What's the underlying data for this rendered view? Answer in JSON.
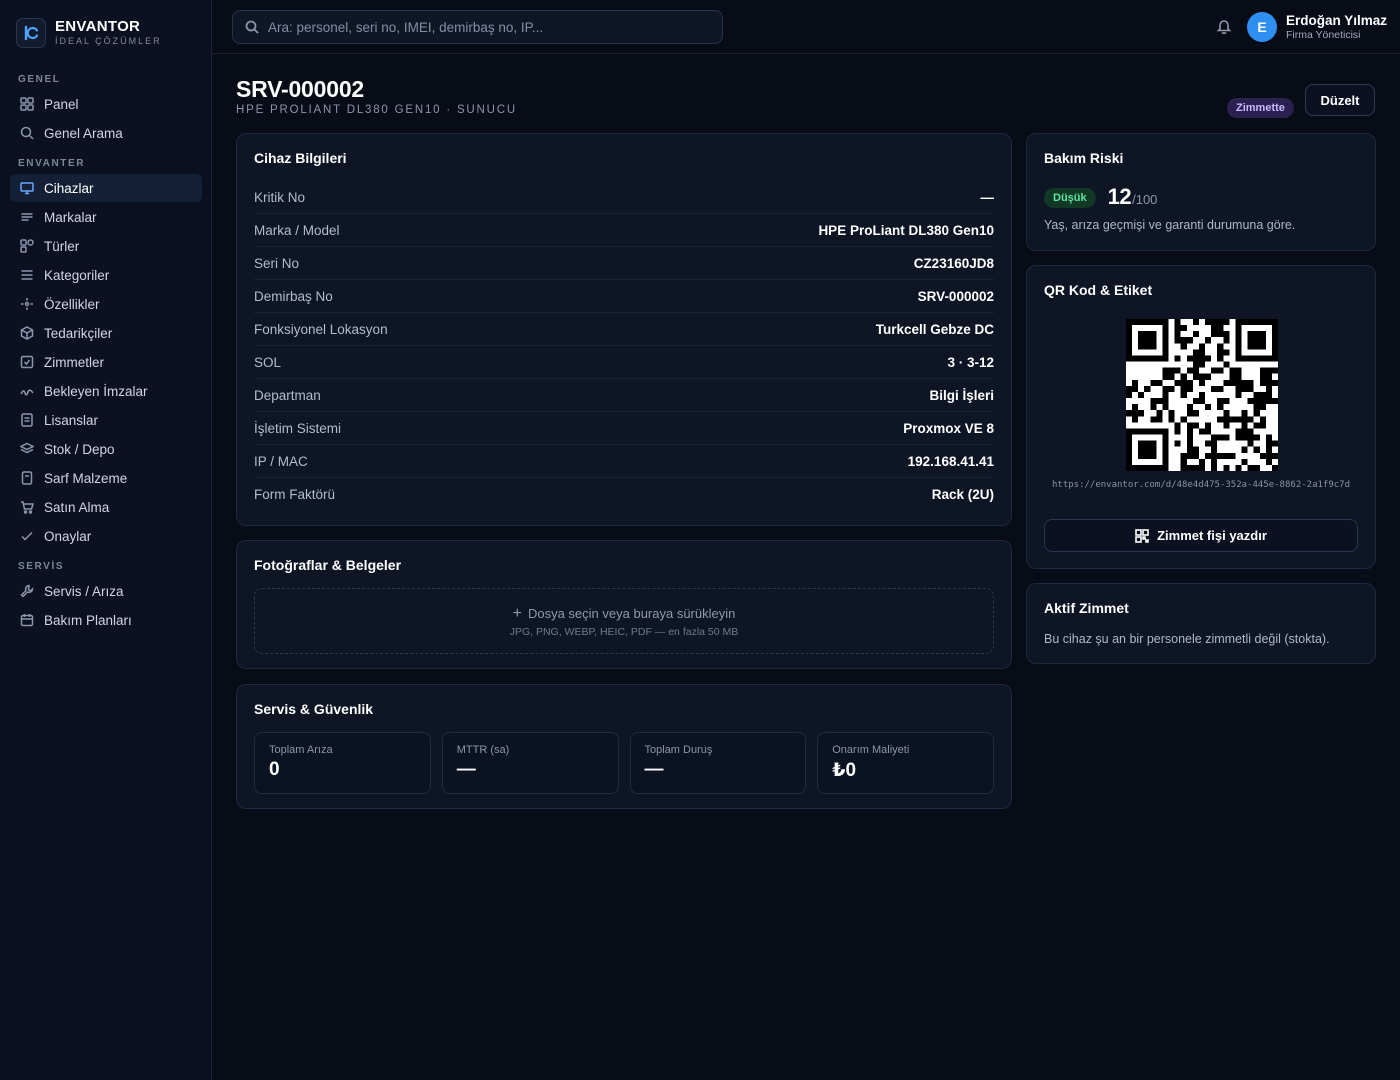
{
  "brand": {
    "name": "ENVANTOR",
    "tagline": "İDEAL ÇÖZÜMLER"
  },
  "sidebar": {
    "sections": [
      {
        "label": "GENEL",
        "items": [
          {
            "label": "Panel",
            "icon": "grid-icon"
          },
          {
            "label": "Genel Arama",
            "icon": "search-icon"
          }
        ]
      },
      {
        "label": "ENVANTER",
        "items": [
          {
            "label": "Cihazlar",
            "icon": "monitor-icon",
            "active": true
          },
          {
            "label": "Markalar",
            "icon": "lines-icon"
          },
          {
            "label": "Türler",
            "icon": "shapes-icon"
          },
          {
            "label": "Kategoriler",
            "icon": "list-icon"
          },
          {
            "label": "Özellikler",
            "icon": "sparkle-icon"
          },
          {
            "label": "Tedarikçiler",
            "icon": "box-icon"
          },
          {
            "label": "Zimmetler",
            "icon": "check-square-icon"
          },
          {
            "label": "Bekleyen İmzalar",
            "icon": "signature-icon"
          },
          {
            "label": "Lisanslar",
            "icon": "document-icon"
          },
          {
            "label": "Stok / Depo",
            "icon": "layers-icon"
          },
          {
            "label": "Sarf Malzeme",
            "icon": "file-icon"
          },
          {
            "label": "Satın Alma",
            "icon": "cart-icon"
          },
          {
            "label": "Onaylar",
            "icon": "check-icon"
          }
        ]
      },
      {
        "label": "SERVİS",
        "items": [
          {
            "label": "Servis / Arıza",
            "icon": "wrench-icon"
          },
          {
            "label": "Bakım Planları",
            "icon": "calendar-icon"
          }
        ]
      }
    ]
  },
  "search": {
    "placeholder": "Ara: personel, seri no, IMEI, demirbaş no, IP..."
  },
  "user": {
    "initial": "E",
    "name": "Erdoğan Yılmaz",
    "role": "Firma Yöneticisi"
  },
  "page": {
    "title": "SRV-000002",
    "subtitle": "HPE PROLIANT DL380 GEN10 · SUNUCU",
    "status_badge": "Zimmette",
    "edit_label": "Düzelt"
  },
  "device_info": {
    "title": "Cihaz Bilgileri",
    "rows": [
      {
        "key": "Kritik No",
        "value": "—"
      },
      {
        "key": "Marka / Model",
        "value": "HPE ProLiant DL380 Gen10"
      },
      {
        "key": "Seri No",
        "value": "CZ23160JD8"
      },
      {
        "key": "Demirbaş No",
        "value": "SRV-000002"
      },
      {
        "key": "Fonksiyonel Lokasyon",
        "value": "Turkcell Gebze DC"
      },
      {
        "key": "SOL",
        "value": "3 · 3-12"
      },
      {
        "key": "Departman",
        "value": "Bilgi İşleri"
      },
      {
        "key": "İşletim Sistemi",
        "value": "Proxmox VE 8"
      },
      {
        "key": "IP / MAC",
        "value": "192.168.41.41"
      },
      {
        "key": "Form Faktörü",
        "value": "Rack (2U)"
      }
    ]
  },
  "photos": {
    "title": "Fotoğraflar & Belgeler",
    "drop_label": "Dosya seçin veya buraya sürükleyin",
    "drop_hint": "JPG, PNG, WEBP, HEIC, PDF — en fazla 50 MB"
  },
  "service": {
    "title": "Servis & Güvenlik",
    "stats": [
      {
        "label": "Toplam Arıza",
        "value": "0"
      },
      {
        "label": "MTTR (sa)",
        "value": "—"
      },
      {
        "label": "Toplam Duruş",
        "value": "—"
      },
      {
        "label": "Onarım Maliyeti",
        "value": "₺0"
      }
    ]
  },
  "risk": {
    "title": "Bakım Riski",
    "level": "Düşük",
    "score": "12",
    "max": "/100",
    "note": "Yaş, arıza geçmişi ve garanti durumuna göre."
  },
  "qr": {
    "title": "QR Kod & Etiket",
    "url": "https://envantor.com/d/48e4d475-352a-445e-8862-2a1f9c7d",
    "print_label": "Zimmet fişi yazdır"
  },
  "active_assignment": {
    "title": "Aktif Zimmet",
    "note": "Bu cihaz şu an bir personele zimmetli değil (stokta)."
  },
  "colors": {
    "accent": "#2f8ff0",
    "background": "#080c16",
    "card": "#0e1525",
    "low_risk": "#5ee3a1",
    "badge_purple": "#c9b8ff"
  }
}
